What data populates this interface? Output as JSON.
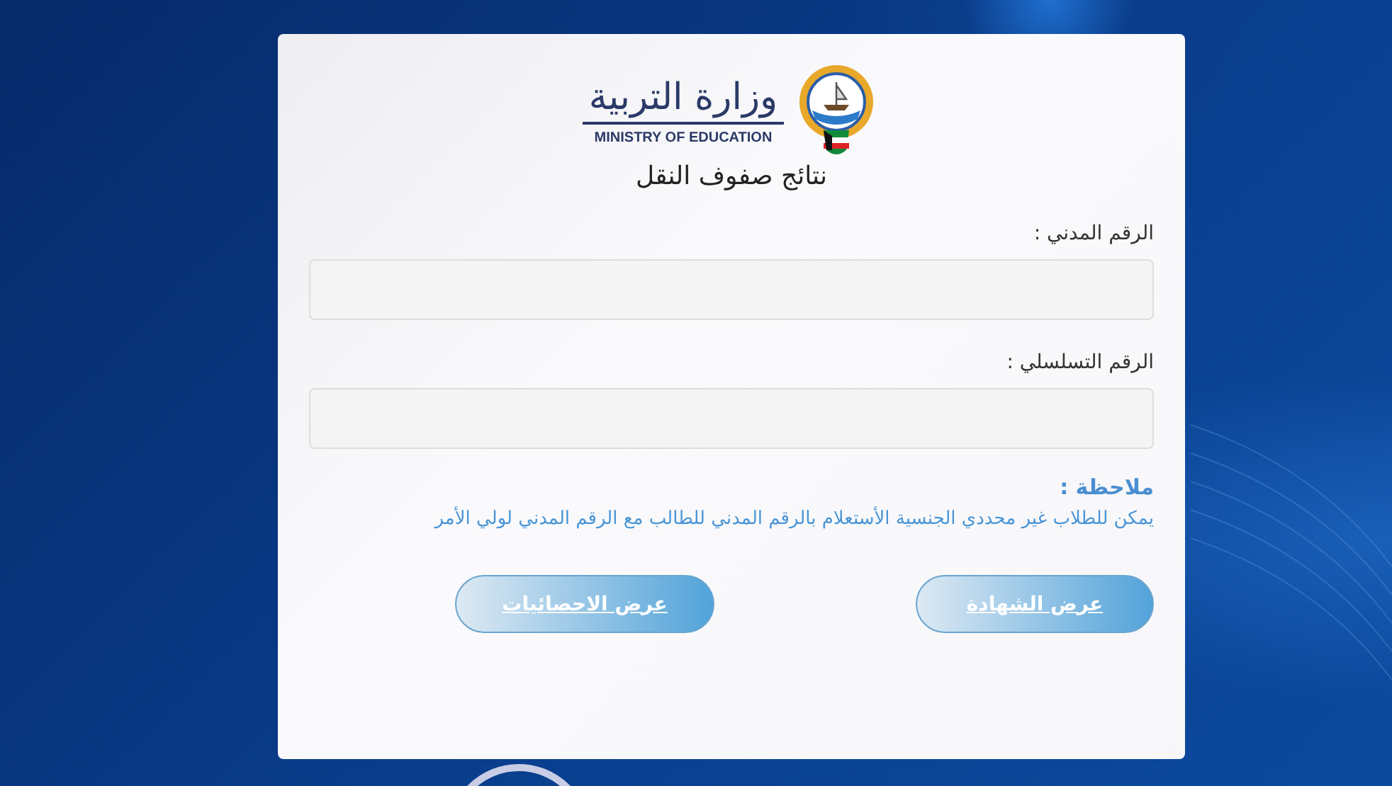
{
  "logo": {
    "arabic_name": "وزارة التربية",
    "english_name": "MINISTRY OF EDUCATION"
  },
  "page_title": "نتائج صفوف النقل",
  "fields": [
    {
      "label": "الرقم المدني :"
    },
    {
      "label": "الرقم التسلسلي :"
    }
  ],
  "note": {
    "title": "ملاحظة :",
    "text": "يمكن للطلاب غير محددي الجنسية الأستعلام بالرقم المدني للطالب مع الرقم المدني لولي الأمر"
  },
  "buttons": [
    "عرض الشهادة",
    "عرض الاحصائيات"
  ]
}
